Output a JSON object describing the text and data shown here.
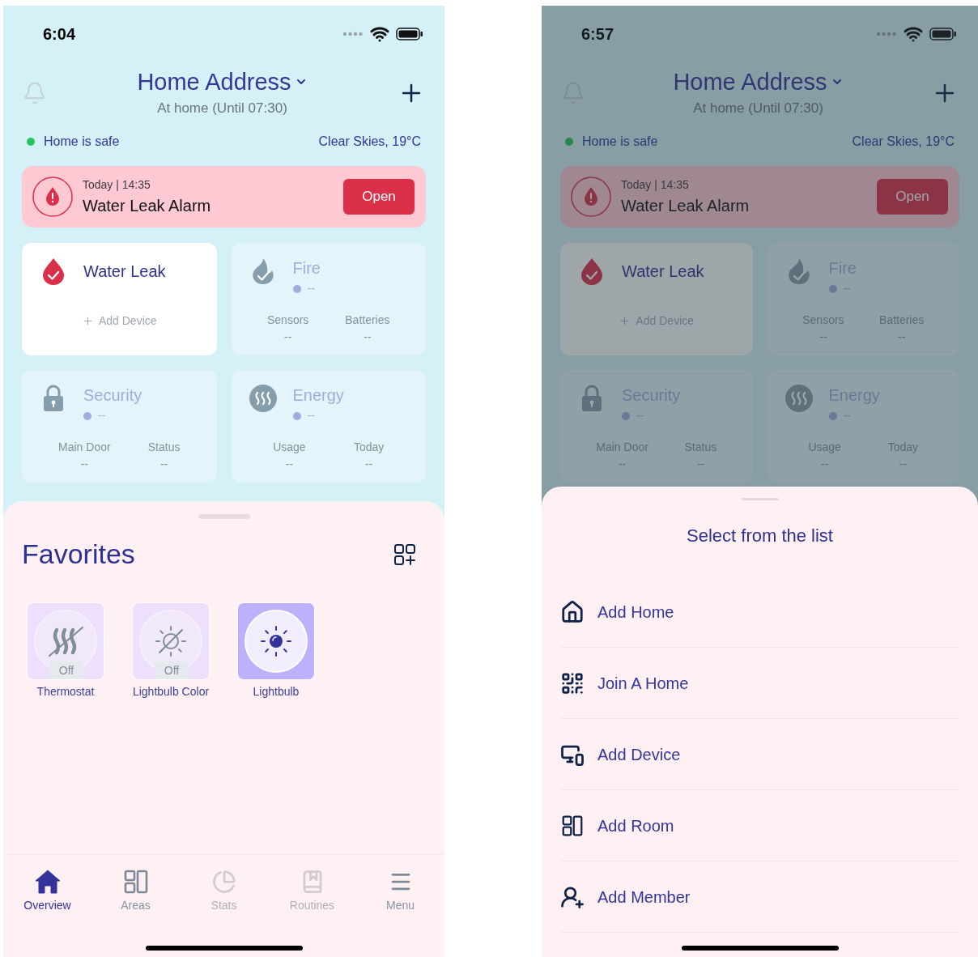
{
  "screens": [
    {
      "dimmed": false,
      "status_bar": {
        "time": "6:04"
      },
      "header": {
        "title": "Home Address",
        "subtitle": "At home (Until 07:30)"
      },
      "status": {
        "text": "Home is safe",
        "weather": "Clear Skies, 19°C"
      },
      "alert": {
        "time": "Today | 14:35",
        "title": "Water Leak Alarm",
        "action": "Open"
      },
      "cards": [
        {
          "kind": "water",
          "title": "Water Leak",
          "active": true,
          "action": "Add Device"
        },
        {
          "kind": "fire",
          "title": "Fire",
          "active": false,
          "status": "--",
          "stats": [
            {
              "label": "Sensors",
              "value": "--"
            },
            {
              "label": "Batteries",
              "value": "--"
            }
          ]
        },
        {
          "kind": "security",
          "title": "Security",
          "active": false,
          "status": "--",
          "stats": [
            {
              "label": "Main Door",
              "value": "--"
            },
            {
              "label": "Status",
              "value": "--"
            }
          ]
        },
        {
          "kind": "energy",
          "title": "Energy",
          "active": false,
          "status": "--",
          "stats": [
            {
              "label": "Usage",
              "value": "--"
            },
            {
              "label": "Today",
              "value": "--"
            }
          ]
        }
      ],
      "favorites": {
        "title": "Favorites",
        "items": [
          {
            "kind": "thermostat",
            "name": "Thermostat",
            "on": false,
            "badge": "Off"
          },
          {
            "kind": "bulb_color",
            "name": "Lightbulb Color",
            "on": false,
            "badge": "Off"
          },
          {
            "kind": "bulb",
            "name": "Lightbulb",
            "on": true
          }
        ]
      },
      "tab_bar": [
        {
          "kind": "home",
          "label": "Overview",
          "selected": true,
          "disabled": false
        },
        {
          "kind": "areas",
          "label": "Areas",
          "selected": false,
          "disabled": false
        },
        {
          "kind": "stats",
          "label": "Stats",
          "selected": false,
          "disabled": true
        },
        {
          "kind": "routines",
          "label": "Routines",
          "selected": false,
          "disabled": true
        },
        {
          "kind": "menu",
          "label": "Menu",
          "selected": false,
          "disabled": false
        }
      ]
    },
    {
      "dimmed": true,
      "status_bar": {
        "time": "6:57"
      },
      "header": {
        "title": "Home Address",
        "subtitle": "At home (Until 07:30)"
      },
      "status": {
        "text": "Home is safe",
        "weather": "Clear Skies, 19°C"
      },
      "alert": {
        "time": "Today | 14:35",
        "title": "Water Leak Alarm",
        "action": "Open"
      },
      "cards": [
        {
          "kind": "water",
          "title": "Water Leak",
          "active": true,
          "action": "Add Device"
        },
        {
          "kind": "fire",
          "title": "Fire",
          "active": false,
          "status": "--",
          "stats": [
            {
              "label": "Sensors",
              "value": "--"
            },
            {
              "label": "Batteries",
              "value": "--"
            }
          ]
        },
        {
          "kind": "security",
          "title": "Security",
          "active": false,
          "status": "--",
          "stats": [
            {
              "label": "Main Door",
              "value": "--"
            },
            {
              "label": "Status",
              "value": "--"
            }
          ]
        },
        {
          "kind": "energy",
          "title": "Energy",
          "active": false,
          "status": "--",
          "stats": [
            {
              "label": "Usage",
              "value": "--"
            },
            {
              "label": "Today",
              "value": "--"
            }
          ]
        }
      ],
      "sheet": {
        "title": "Select from the list",
        "items": [
          {
            "kind": "home",
            "label": "Add Home"
          },
          {
            "kind": "qr",
            "label": "Join A Home"
          },
          {
            "kind": "device",
            "label": "Add Device"
          },
          {
            "kind": "room",
            "label": "Add Room"
          },
          {
            "kind": "member",
            "label": "Add Member"
          }
        ]
      }
    }
  ]
}
